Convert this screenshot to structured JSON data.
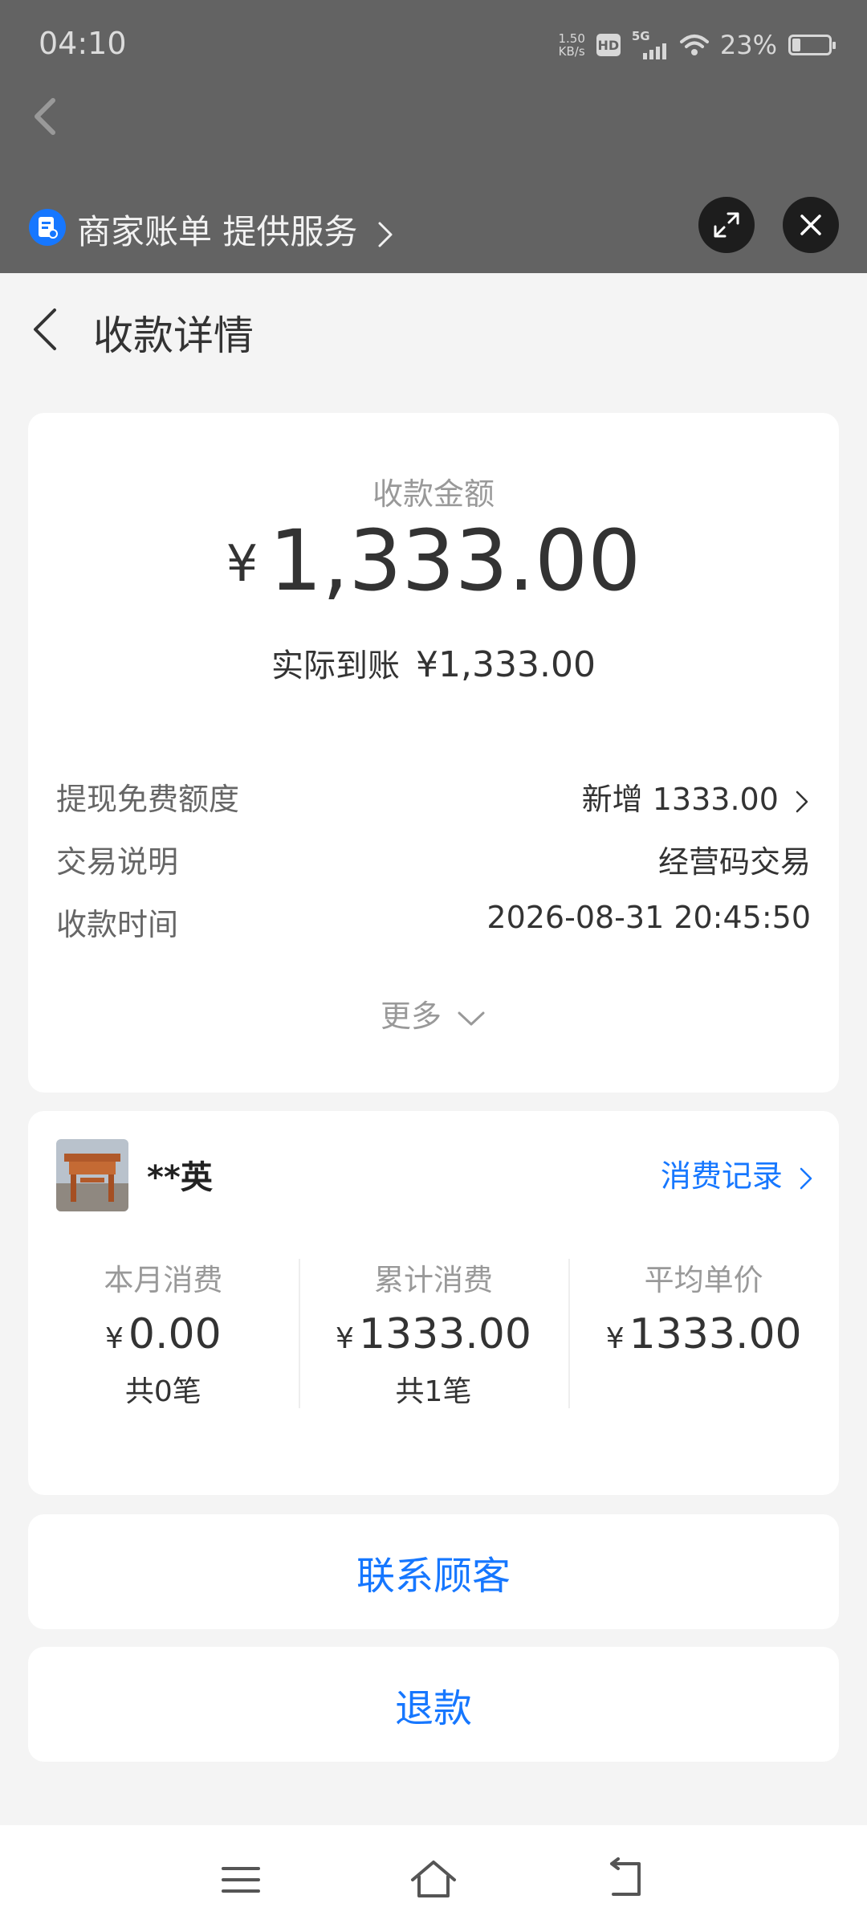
{
  "status_bar": {
    "time": "04:10",
    "net_speed_value": "1.50",
    "net_speed_unit": "KB/s",
    "hd": "HD",
    "signal": "5G",
    "battery": "23%",
    "battery_level": 0.23
  },
  "mini_bar": {
    "title": "商家账单 提供服务",
    "app_icon": "bill-icon",
    "expand_icon": "expand-icon",
    "close_icon": "close-icon"
  },
  "header": {
    "title": "收款详情",
    "back_icon": "back-arrow-icon"
  },
  "amount_card": {
    "label": "收款金额",
    "currency": "¥",
    "amount": "1,333.00",
    "actual_label": "实际到账",
    "actual_value": "¥1,333.00",
    "rows": [
      {
        "label": "提现免费额度",
        "value": "新增 1333.00"
      },
      {
        "label": "交易说明",
        "value": "经营码交易"
      },
      {
        "label": "收款时间",
        "value": "2026-08-31 20:45:50"
      }
    ],
    "more_label": "更多"
  },
  "customer_card": {
    "name": "**英",
    "record_link": "消费记录",
    "stats": [
      {
        "label": "本月消费",
        "currency": "¥",
        "value": "0.00",
        "count": "共0笔"
      },
      {
        "label": "累计消费",
        "currency": "¥",
        "value": "1333.00",
        "count": "共1笔"
      },
      {
        "label": "平均单价",
        "currency": "¥",
        "value": "1333.00",
        "count": ""
      }
    ]
  },
  "actions": {
    "contact": "联系顾客",
    "refund": "退款"
  },
  "nav_bar": {
    "menu_icon": "menu-icon",
    "home_icon": "home-icon",
    "back_icon": "back-icon"
  },
  "colors": {
    "accent": "#1677ff",
    "overlay": "#636363",
    "page_bg": "#f4f4f4"
  }
}
